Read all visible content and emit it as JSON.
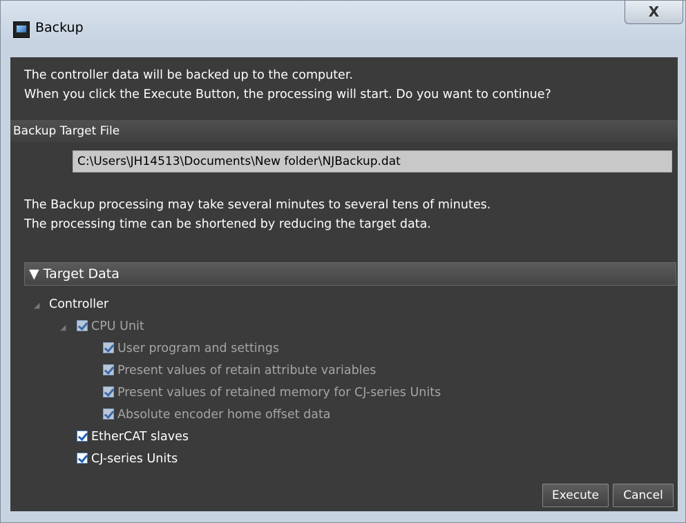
{
  "window": {
    "title": "Backup",
    "close_label": "X"
  },
  "intro": {
    "line1": "The controller data will be backed up to the computer.",
    "line2": "When you click the Execute Button, the processing will start. Do you want to continue?"
  },
  "target_file": {
    "header": "Backup Target File",
    "path": "C:\\Users\\JH14513\\Documents\\New folder\\NJBackup.dat"
  },
  "note": {
    "line1": "The Backup processing may take several minutes to several tens of minutes.",
    "line2": "The processing time can be shortened by reducing the target data."
  },
  "target_data": {
    "header": "▼ Target Data",
    "controller": "Controller",
    "cpu_unit": "CPU Unit",
    "cpu_children": [
      "User program and settings",
      "Present values of retain attribute variables",
      "Present values of retained memory for CJ-series Units",
      "Absolute encoder home offset data"
    ],
    "ethercat": "EtherCAT slaves",
    "cj_units": "CJ-series Units"
  },
  "buttons": {
    "execute": "Execute",
    "cancel": "Cancel"
  },
  "colors": {
    "client_bg": "#3b3b3b",
    "check_blue": "#1f5fb8"
  }
}
